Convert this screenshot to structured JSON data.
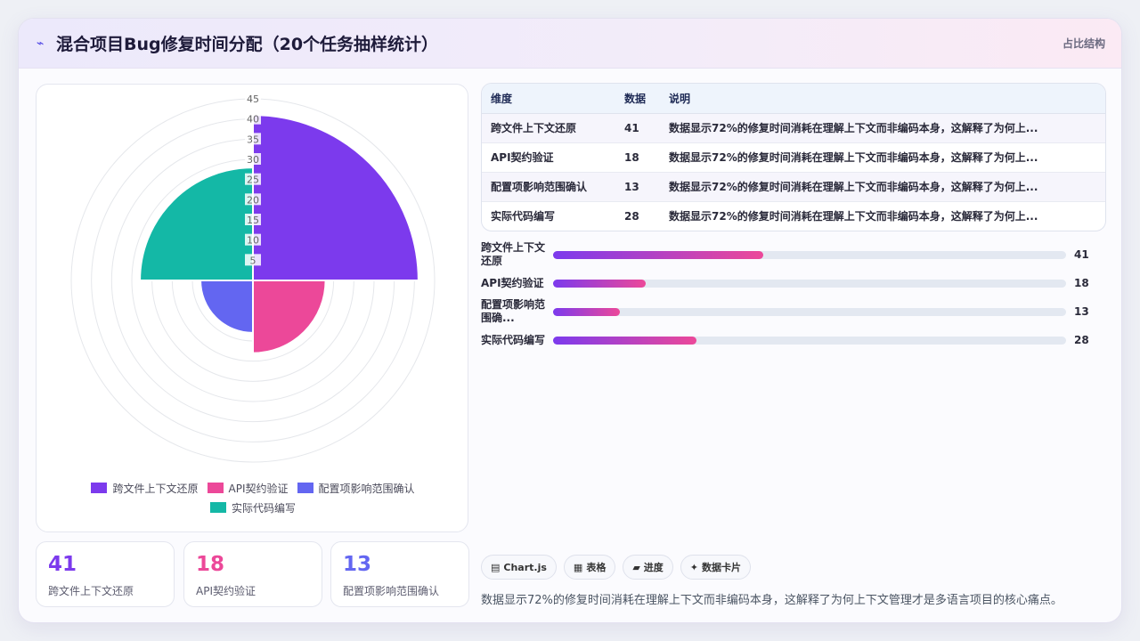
{
  "header": {
    "title": "混合项目Bug修复时间分配（20个任务抽样统计）",
    "tag": "占比结构"
  },
  "chart_data": {
    "type": "polarArea",
    "categories": [
      "跨文件上下文还原",
      "API契约验证",
      "配置项影响范围确认",
      "实际代码编写"
    ],
    "values": [
      41,
      18,
      13,
      28
    ],
    "colors": [
      "#7c3aed",
      "#ec4899",
      "#6366f1",
      "#14b8a6"
    ],
    "r_ticks": [
      5,
      10,
      15,
      20,
      25,
      30,
      35,
      40,
      45
    ],
    "rlim": [
      0,
      45
    ],
    "legend_position": "bottom"
  },
  "stats": [
    {
      "value": "41",
      "label": "跨文件上下文还原",
      "color": "#7c3aed"
    },
    {
      "value": "18",
      "label": "API契约验证",
      "color": "#ec4899"
    },
    {
      "value": "13",
      "label": "配置项影响范围确认",
      "color": "#6366f1"
    }
  ],
  "table": {
    "headers": [
      "维度",
      "数据",
      "说明"
    ],
    "rows": [
      [
        "跨文件上下文还原",
        "41",
        "数据显示72%的修复时间消耗在理解上下文而非编码本身，这解释了为何上..."
      ],
      [
        "API契约验证",
        "18",
        "数据显示72%的修复时间消耗在理解上下文而非编码本身，这解释了为何上..."
      ],
      [
        "配置项影响范围确认",
        "13",
        "数据显示72%的修复时间消耗在理解上下文而非编码本身，这解释了为何上..."
      ],
      [
        "实际代码编写",
        "28",
        "数据显示72%的修复时间消耗在理解上下文而非编码本身，这解释了为何上..."
      ]
    ]
  },
  "progress": {
    "max": 100,
    "items": [
      {
        "label": "跨文件上下文还原",
        "value": 41
      },
      {
        "label": "API契约验证",
        "value": 18
      },
      {
        "label": "配置项影响范围确...",
        "value": 13
      },
      {
        "label": "实际代码编写",
        "value": 28
      }
    ]
  },
  "chips": [
    {
      "icon": "▤",
      "icon_name": "chart-icon",
      "label": "Chart.js"
    },
    {
      "icon": "▦",
      "icon_name": "table-icon",
      "label": "表格"
    },
    {
      "icon": "▰",
      "icon_name": "progress-icon",
      "label": "进度"
    },
    {
      "icon": "✦",
      "icon_name": "sparkle-icon",
      "label": "数据卡片"
    }
  ],
  "summary": "数据显示72%的修复时间消耗在理解上下文而非编码本身，这解释了为何上下文管理才是多语言项目的核心痛点。"
}
